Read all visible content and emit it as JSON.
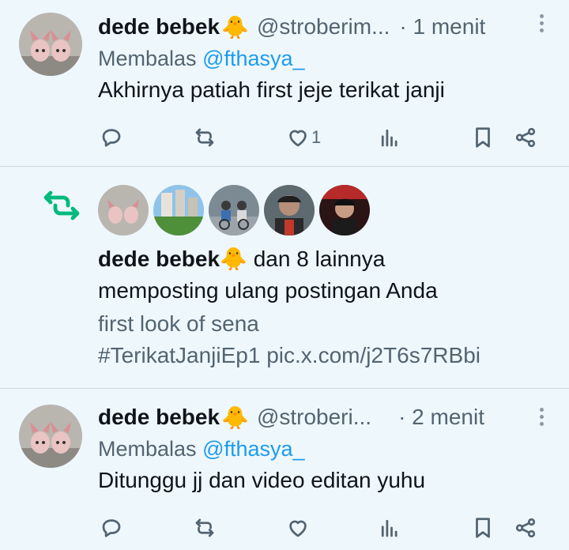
{
  "notifications": [
    {
      "type": "reply",
      "author_name": "dede bebek",
      "author_emoji": "🐥",
      "handle": "@stroberim...",
      "time": "· 1 menit",
      "reply_prefix": "Membalas",
      "reply_to": "@fthasya_",
      "text": "Akhirnya patiah first jeje terikat janji",
      "like_count": "1"
    },
    {
      "type": "repost",
      "author_name": "dede bebek",
      "author_emoji": "🐥",
      "others": "dan 8 lainnya",
      "action_text": "memposting ulang postingan Anda",
      "quoted_line1": "first look of sena",
      "quoted_line2": "#TerikatJanjiEp1 pic.x.com/j2T6s7RBbi"
    },
    {
      "type": "reply",
      "author_name": "dede bebek",
      "author_emoji": "🐥",
      "handle": "@stroberi...",
      "time": "· 2 menit",
      "reply_prefix": "Membalas",
      "reply_to": "@fthasya_",
      "text": "Ditunggu jj dan video editan yuhu",
      "like_count": ""
    }
  ],
  "colors": {
    "background": "#eef7fc",
    "link": "#1d9bf0",
    "repost_green": "#00ba7c",
    "muted": "#536471"
  },
  "icons": [
    "reply-icon",
    "repost-icon",
    "like-icon",
    "views-icon",
    "bookmark-icon",
    "share-icon",
    "more-icon"
  ]
}
